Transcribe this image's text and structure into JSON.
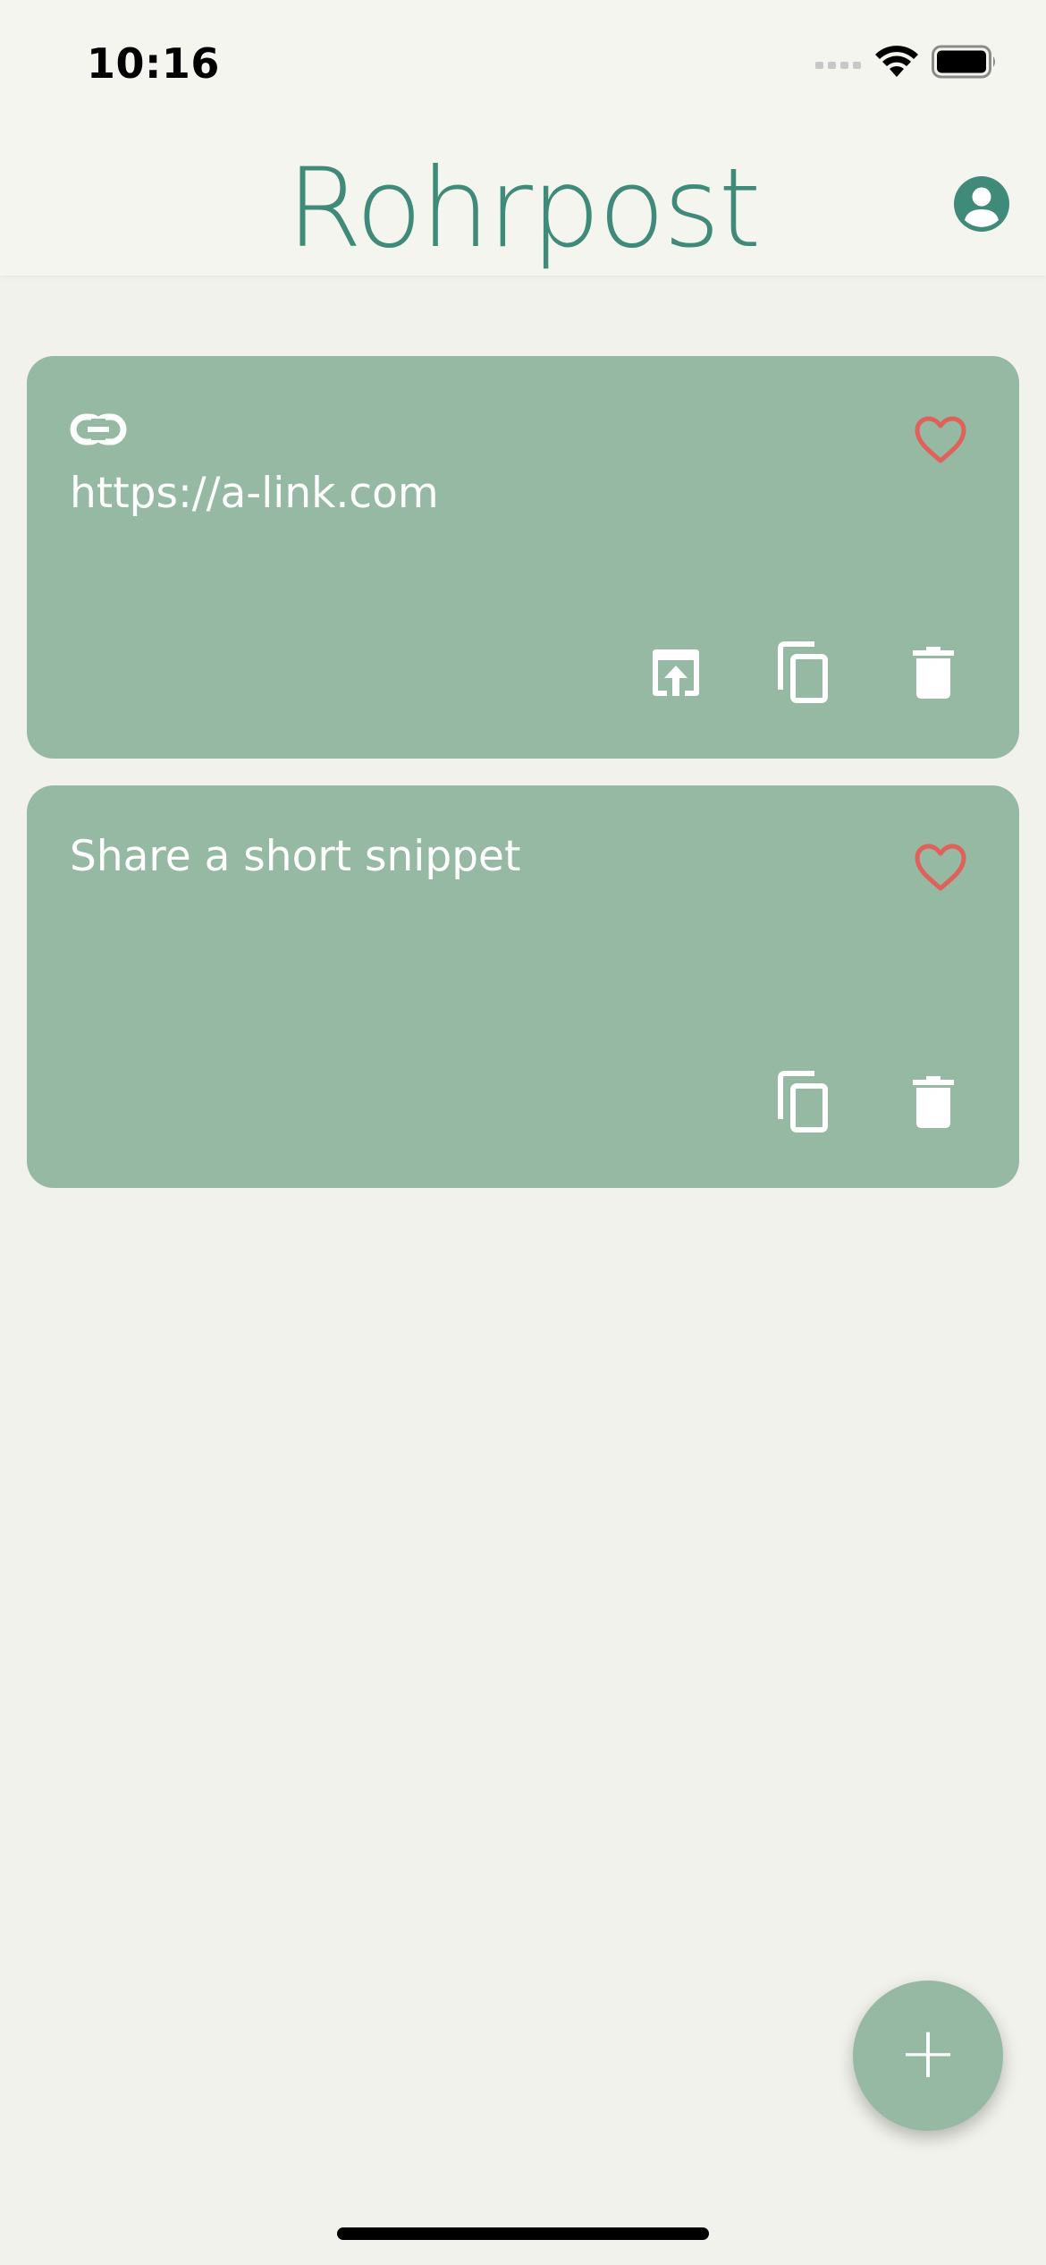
{
  "status_bar": {
    "time": "10:16"
  },
  "header": {
    "title": "Rohrpost",
    "account_icon": "account-circle-icon"
  },
  "cards": [
    {
      "type": "link",
      "type_icon": "link-icon",
      "text": "https://a-link.com",
      "favorite_icon": "heart-outline-icon",
      "actions": [
        "open-icon",
        "copy-icon",
        "delete-icon"
      ]
    },
    {
      "type": "text",
      "text": "Share a short snippet",
      "favorite_icon": "heart-outline-icon",
      "actions": [
        "copy-icon",
        "delete-icon"
      ]
    }
  ],
  "fab": {
    "label": "+"
  },
  "colors": {
    "background": "#f2f2ec",
    "accent": "#3f8a78",
    "card": "#95b9a3",
    "favorite": "#e0605a"
  }
}
